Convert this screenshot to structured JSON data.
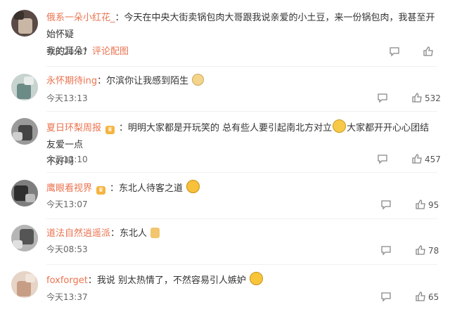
{
  "comments": [
    {
      "user": "俄系一朵小红花_",
      "text_line1": "：今天在中央大街卖锅包肉大哥跟我说亲爱的小土豆，来一份锅包肉，我甚至开始怀疑",
      "text_line2": "我的耳朵！",
      "link": "评论配图",
      "time": "今天20:57",
      "likes": ""
    },
    {
      "user": "永怀期待ing",
      "text": "：尔滨你让我感到陌生",
      "time": "今天13:13",
      "likes": "532"
    },
    {
      "user": "夏日环梨周报",
      "text_part1": "：明明大家都是开玩笑的 总有些人要引起南北方对立",
      "text_part2": "大家都开开心心团结友爱一点",
      "text_line2": "不好吗",
      "time": "今天13:10",
      "likes": "457"
    },
    {
      "user": "鹰眼看视界",
      "text": "：东北人待客之道",
      "time": "今天13:07",
      "likes": "95"
    },
    {
      "user": "道法自然逍遥派",
      "text": "：东北人",
      "time": "今天08:53",
      "likes": "78"
    },
    {
      "user": "foxforget",
      "text": "：我说 别太热情了，不然容易引人嫉妒",
      "time": "今天13:37",
      "likes": "65"
    }
  ],
  "colors": {
    "username": "#eb7350",
    "text": "#333333",
    "meta": "#666666"
  }
}
